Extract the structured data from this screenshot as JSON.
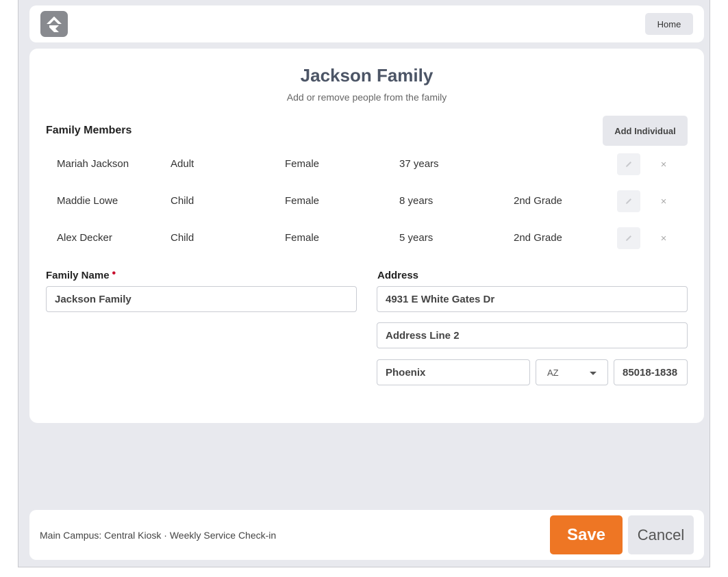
{
  "header": {
    "logo_icon": "rock-logo-icon",
    "home_label": "Home"
  },
  "family": {
    "title": "Jackson Family",
    "subtitle": "Add or remove people from the family",
    "members_heading": "Family Members",
    "add_individual_label": "Add Individual",
    "members": [
      {
        "name": "Mariah Jackson",
        "role": "Adult",
        "gender": "Female",
        "age": "37 years",
        "grade": ""
      },
      {
        "name": "Maddie Lowe",
        "role": "Child",
        "gender": "Female",
        "age": "8 years",
        "grade": "2nd Grade"
      },
      {
        "name": "Alex Decker",
        "role": "Child",
        "gender": "Female",
        "age": "5 years",
        "grade": "2nd Grade"
      }
    ],
    "remove_symbol": "×"
  },
  "form": {
    "family_name_label": "Family Name",
    "required_marker": "•",
    "family_name_value": "Jackson Family",
    "address_label": "Address",
    "address_line1": "4931 E White Gates Dr",
    "address_line2_placeholder": "Address Line 2",
    "city": "Phoenix",
    "state": "AZ",
    "zip": "85018-1838"
  },
  "footer": {
    "location_text": "Main Campus: Central Kiosk · Weekly Service Check-in",
    "save_label": "Save",
    "cancel_label": "Cancel"
  },
  "colors": {
    "accent": "#ee7624",
    "required": "#c8102e",
    "background": "#e8e9ee"
  }
}
